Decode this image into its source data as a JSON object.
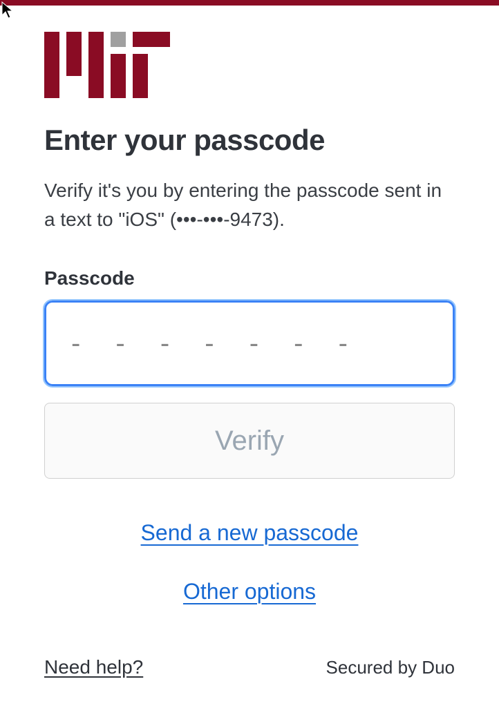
{
  "colors": {
    "brand": "#8a0c24",
    "link": "#1769d3"
  },
  "heading": "Enter your passcode",
  "description": "Verify it's you by entering the passcode sent in a text to \"iOS\" (•••-•••-9473).",
  "passcode": {
    "label": "Passcode",
    "value": "",
    "placeholder": "- - - - - - -"
  },
  "verify_button": "Verify",
  "links": {
    "send_new": "Send a new passcode",
    "other_options": "Other options"
  },
  "footer": {
    "help": "Need help?",
    "secured": "Secured by Duo"
  }
}
